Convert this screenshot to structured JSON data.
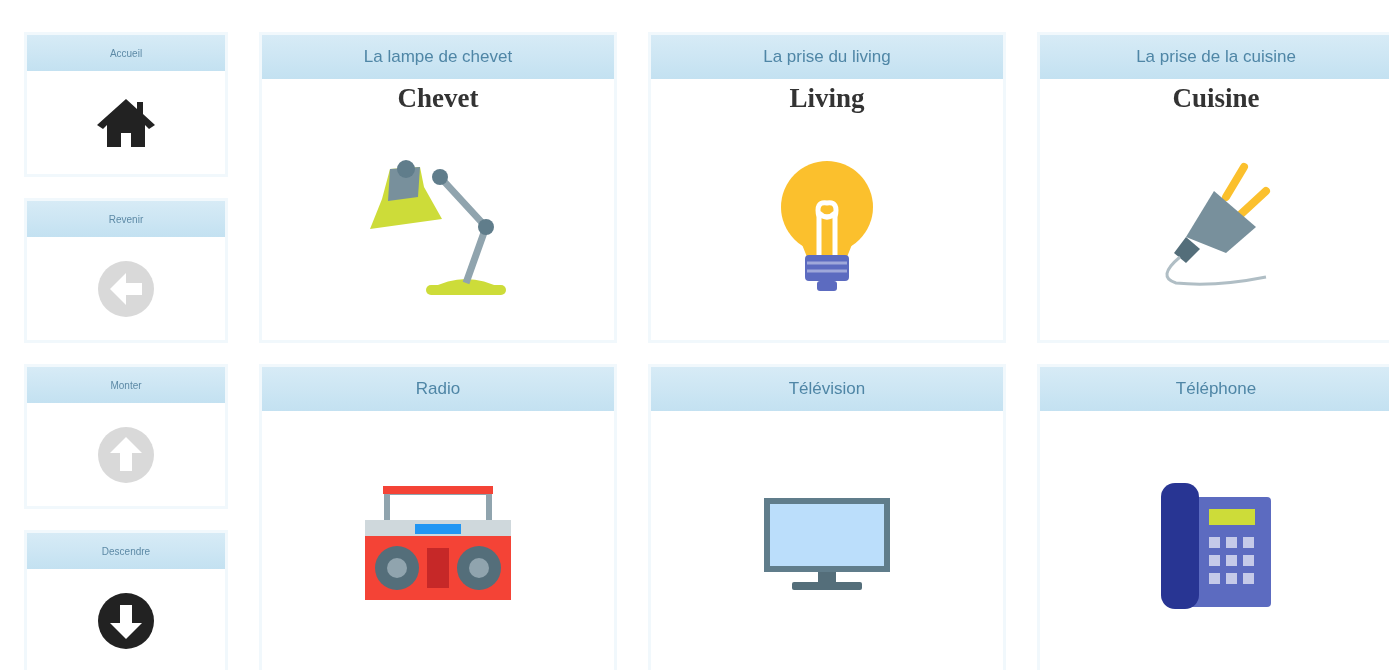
{
  "sidebar": {
    "items": [
      {
        "label": "Accueil",
        "kind": "home",
        "disabled": false
      },
      {
        "label": "Revenir",
        "kind": "back",
        "disabled": true
      },
      {
        "label": "Monter",
        "kind": "up",
        "disabled": true
      },
      {
        "label": "Descendre",
        "kind": "down",
        "disabled": false
      }
    ]
  },
  "tiles": [
    {
      "title": "La lampe de chevet",
      "subtitle": "Chevet",
      "kind": "lamp"
    },
    {
      "title": "La prise du living",
      "subtitle": "Living",
      "kind": "bulb"
    },
    {
      "title": "La prise de la cuisine",
      "subtitle": "Cuisine",
      "kind": "plug"
    },
    {
      "title": "Radio",
      "kind": "radio"
    },
    {
      "title": "Télévision",
      "kind": "tv"
    },
    {
      "title": "Téléphone",
      "kind": "phone"
    }
  ]
}
